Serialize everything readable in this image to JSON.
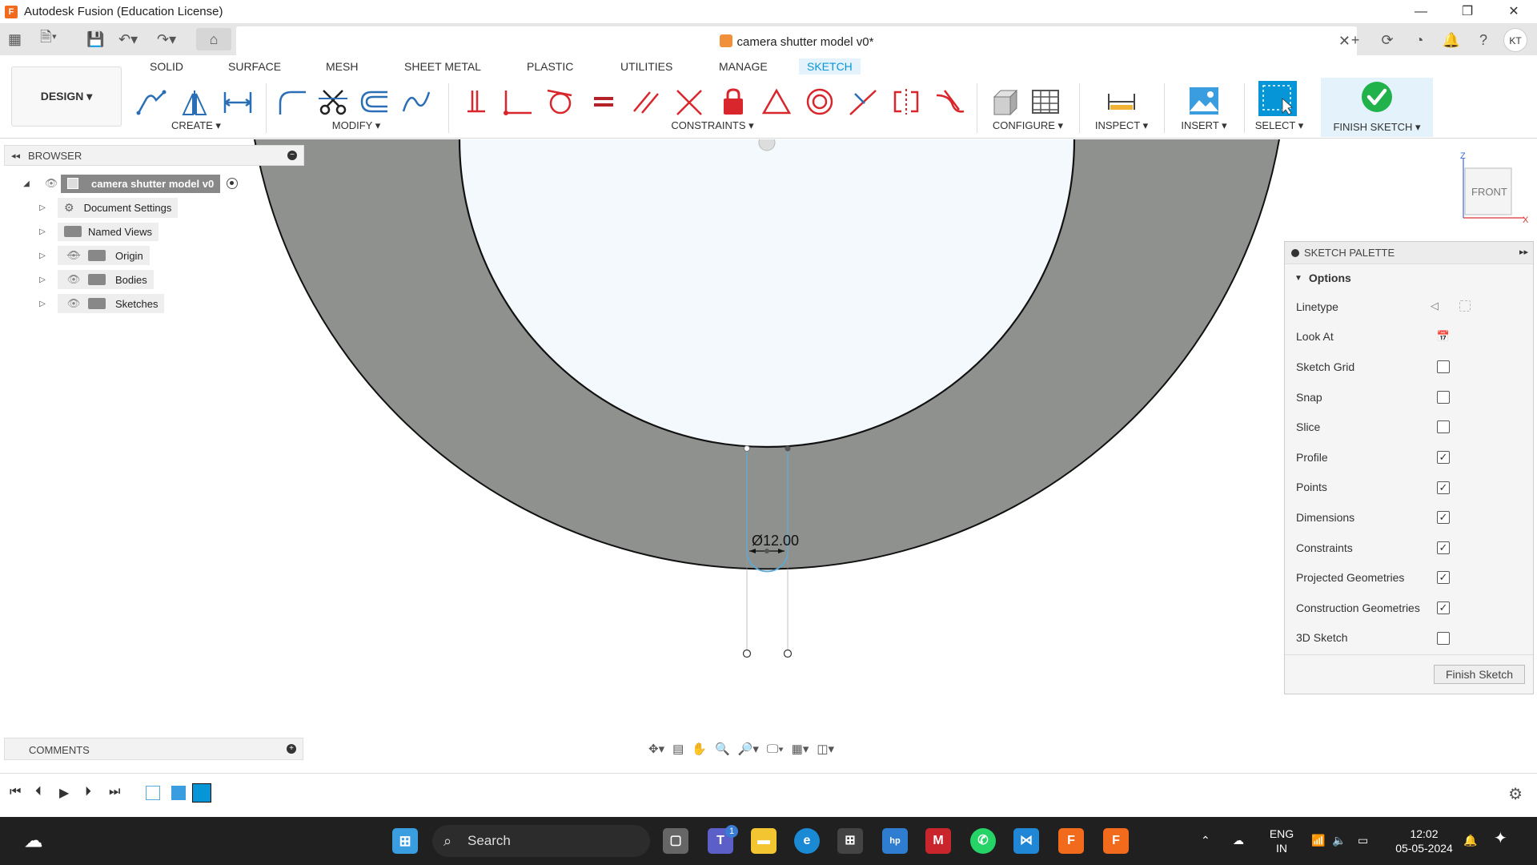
{
  "window": {
    "app_icon": "F",
    "title": "Autodesk Fusion (Education License)",
    "controls": [
      "—",
      "❐",
      "✕"
    ]
  },
  "document": {
    "tab_title": "camera shutter model v0*",
    "close": "✕",
    "avatar": "KT"
  },
  "ribbon": {
    "workspace": "DESIGN ▾",
    "tabs": [
      "SOLID",
      "SURFACE",
      "MESH",
      "SHEET METAL",
      "PLASTIC",
      "UTILITIES",
      "MANAGE",
      "SKETCH"
    ],
    "active_tab": "SKETCH",
    "groups": {
      "create": "CREATE ▾",
      "modify": "MODIFY ▾",
      "constraints": "CONSTRAINTS ▾",
      "configure": "CONFIGURE ▾",
      "inspect": "INSPECT ▾",
      "insert": "INSERT ▾",
      "select": "SELECT ▾",
      "finish": "FINISH SKETCH ▾"
    }
  },
  "browser": {
    "title": "BROWSER",
    "items": [
      {
        "label": "camera shutter model v0"
      },
      {
        "label": "Document Settings"
      },
      {
        "label": "Named Views"
      },
      {
        "label": "Origin"
      },
      {
        "label": "Bodies"
      },
      {
        "label": "Sketches"
      }
    ]
  },
  "comments": {
    "title": "COMMENTS"
  },
  "viewcube": {
    "face": "FRONT",
    "z_axis": "Z",
    "x_axis": "X"
  },
  "dimension": {
    "label": "Ø12.00"
  },
  "palette": {
    "title": "SKETCH PALETTE",
    "section": "Options",
    "rows": [
      {
        "label": "Linetype",
        "type": "icon",
        "checked": false
      },
      {
        "label": "Look At",
        "type": "icon",
        "checked": false
      },
      {
        "label": "Sketch Grid",
        "type": "checkbox",
        "checked": false
      },
      {
        "label": "Snap",
        "type": "checkbox",
        "checked": false
      },
      {
        "label": "Slice",
        "type": "checkbox",
        "checked": false
      },
      {
        "label": "Profile",
        "type": "checkbox",
        "checked": true
      },
      {
        "label": "Points",
        "type": "checkbox",
        "checked": true
      },
      {
        "label": "Dimensions",
        "type": "checkbox",
        "checked": true
      },
      {
        "label": "Constraints",
        "type": "checkbox",
        "checked": true
      },
      {
        "label": "Projected Geometries",
        "type": "checkbox",
        "checked": true
      },
      {
        "label": "Construction Geometries",
        "type": "checkbox",
        "checked": true
      },
      {
        "label": "3D Sketch",
        "type": "checkbox",
        "checked": false
      }
    ],
    "finish_button": "Finish Sketch"
  },
  "taskbar": {
    "search_placeholder": "Search",
    "language_top": "ENG",
    "language_bottom": "IN",
    "time": "12:02",
    "date": "05-05-2024",
    "teams_badge": "1"
  },
  "colors": {
    "accent": "#0696d7",
    "body_gray": "#8f918f",
    "face_blue": "#f3f9fd",
    "sketch_line": "#5aa9d6",
    "constraint_red": "#d9262c",
    "finish_green": "#21b24b"
  }
}
